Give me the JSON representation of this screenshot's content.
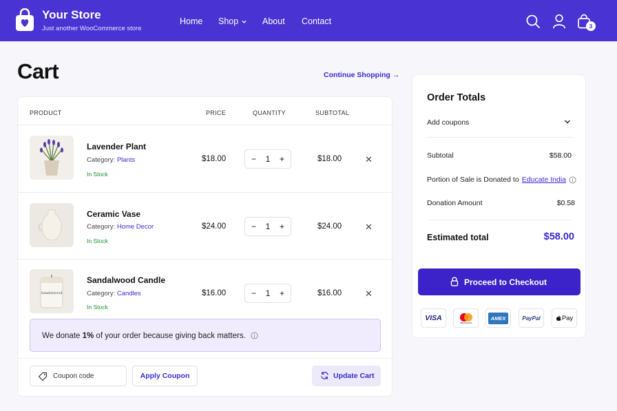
{
  "header": {
    "brand_title": "Your Store",
    "brand_subtitle": "Just another WooCommerce store",
    "nav": [
      "Home",
      "Shop",
      "About",
      "Contact"
    ],
    "cart_count": "3",
    "icons": [
      "search-icon",
      "user-icon",
      "cart-bag-icon",
      "chevron-down-icon"
    ],
    "colors": {
      "header_bg": "#4a33d3",
      "accent": "#3b2ad0",
      "stock": "#17902e"
    }
  },
  "cart": {
    "title": "Cart",
    "continue_label": "Continue Shopping →",
    "columns": [
      "PRODUCT",
      "PRICE",
      "QUANTITY",
      "SUBTOTAL"
    ],
    "items": [
      {
        "name": "Lavender Plant",
        "category_label": "Category:",
        "category": "Plants",
        "stock": "In Stock",
        "price": "$18.00",
        "qty": "1",
        "subtotal": "$18.00"
      },
      {
        "name": "Ceramic Vase",
        "category_label": "Category:",
        "category": "Home Decor",
        "stock": "In Stock",
        "price": "$24.00",
        "qty": "1",
        "subtotal": "$24.00"
      },
      {
        "name": "Sandalwood Candle",
        "category_label": "Category:",
        "category": "Candles",
        "stock": "In Stock",
        "price": "$16.00",
        "qty": "1",
        "subtotal": "$16.00"
      }
    ],
    "candle_label": "Sandalwood",
    "donate_pre": "We donate ",
    "donate_pct": "1%",
    "donate_post": " of your order because giving back matters.",
    "coupon_placeholder": "Coupon code",
    "apply_label": "Apply Coupon",
    "update_label": "Update Cart"
  },
  "totals": {
    "title": "Order Totals",
    "add_coupons": "Add coupons",
    "subtotal_label": "Subtotal",
    "subtotal_value": "$58.00",
    "portion_label": "Portion of Sale is Donated to",
    "portion_value": "Educate India",
    "donation_label": "Donation Amount",
    "donation_value": "$0.58",
    "estimated_label": "Estimated total",
    "estimated_value": "$58.00",
    "checkout_label": "Proceed to Checkout",
    "payments": [
      "VISA",
      "Mastercard",
      "AMEX",
      "PayPal",
      "Pay"
    ]
  }
}
